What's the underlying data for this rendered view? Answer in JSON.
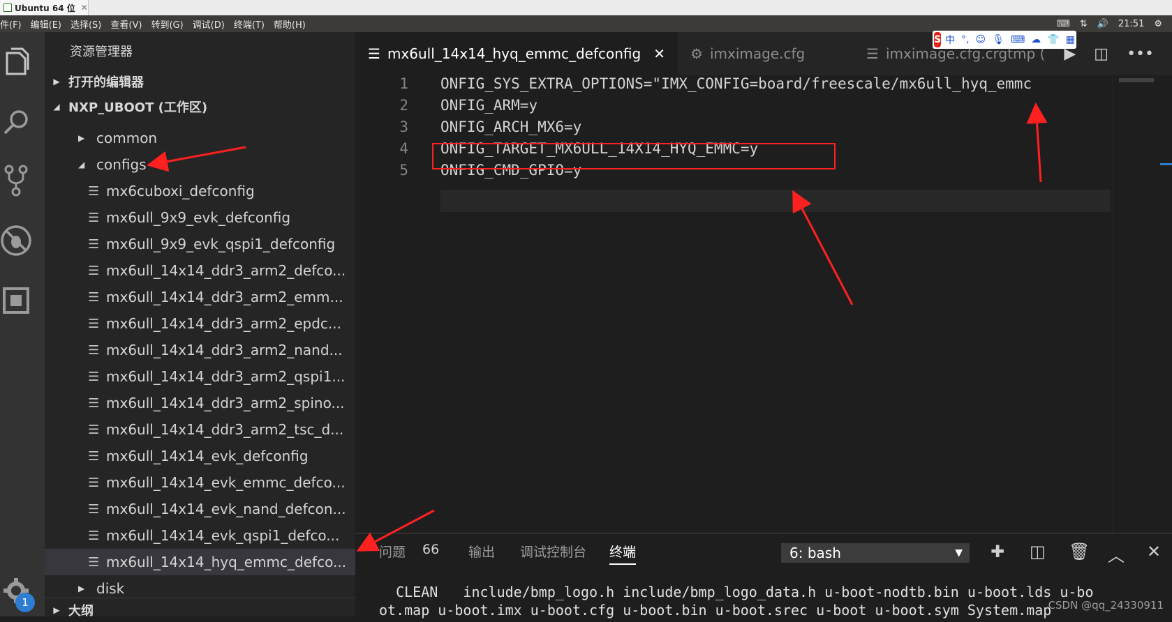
{
  "os": {
    "tab_title": "Ubuntu 64 位",
    "close": "✕",
    "clock": "21:51"
  },
  "menu": [
    "件(F)",
    "编辑(E)",
    "选择(S)",
    "查看(V)",
    "转到(G)",
    "调试(D)",
    "终端(T)",
    "帮助(H)"
  ],
  "ime": {
    "logo": "S",
    "mode": "中",
    "punct": "°,"
  },
  "sidebar": {
    "title": "资源管理器",
    "open_editors": "打开的编辑器",
    "workspace": "NXP_UBOOT (工作区)",
    "outline": "大纲",
    "folders": {
      "common": "common",
      "configs": "configs",
      "disk": "disk"
    },
    "files": [
      "mx6cuboxi_defconfig",
      "mx6ull_9x9_evk_defconfig",
      "mx6ull_9x9_evk_qspi1_defconfig",
      "mx6ull_14x14_ddr3_arm2_defco...",
      "mx6ull_14x14_ddr3_arm2_emm...",
      "mx6ull_14x14_ddr3_arm2_epdc...",
      "mx6ull_14x14_ddr3_arm2_nand...",
      "mx6ull_14x14_ddr3_arm2_qspi1...",
      "mx6ull_14x14_ddr3_arm2_spino...",
      "mx6ull_14x14_ddr3_arm2_tsc_d...",
      "mx6ull_14x14_evk_defconfig",
      "mx6ull_14x14_evk_emmc_defco...",
      "mx6ull_14x14_evk_nand_defcon...",
      "mx6ull_14x14_evk_qspi1_defco...",
      "mx6ull_14x14_hyq_emmc_defco..."
    ],
    "badge": "1"
  },
  "tabs": [
    {
      "label": "mx6ull_14x14_hyq_emmc_defconfig",
      "close": "✕"
    },
    {
      "label": "imximage.cfg"
    },
    {
      "label": "imximage.cfg.crgtmp ("
    }
  ],
  "editor": {
    "line_numbers": [
      "1",
      "2",
      "3",
      "4",
      "5"
    ],
    "lines": [
      "ONFIG_SYS_EXTRA_OPTIONS=\"IMX_CONFIG=board/freescale/mx6ull_hyq_emmc",
      "ONFIG_ARM=y",
      "ONFIG_ARCH_MX6=y",
      "ONFIG_TARGET_MX6ULL_14X14_HYQ_EMMC=y",
      "ONFIG_CMD_GPIO=y"
    ]
  },
  "panel": {
    "tabs": {
      "problems": "问题",
      "problems_count": "66",
      "output": "输出",
      "debug_console": "调试控制台",
      "terminal": "终端"
    },
    "terminal_select": "6: bash",
    "terminal_lines": [
      "  CLEAN   include/bmp_logo.h include/bmp_logo_data.h u-boot-nodtb.bin u-boot.lds u-bo",
      "ot.map u-boot.imx u-boot.cfg u-boot.bin u-boot.srec u-boot u-boot.sym System.map"
    ]
  },
  "watermark": "CSDN @qq_24330911",
  "colors": {
    "annotation": "#ff2020",
    "activity_bar": "#333333",
    "sidebar": "#252526",
    "editor": "#1e1e1e"
  }
}
